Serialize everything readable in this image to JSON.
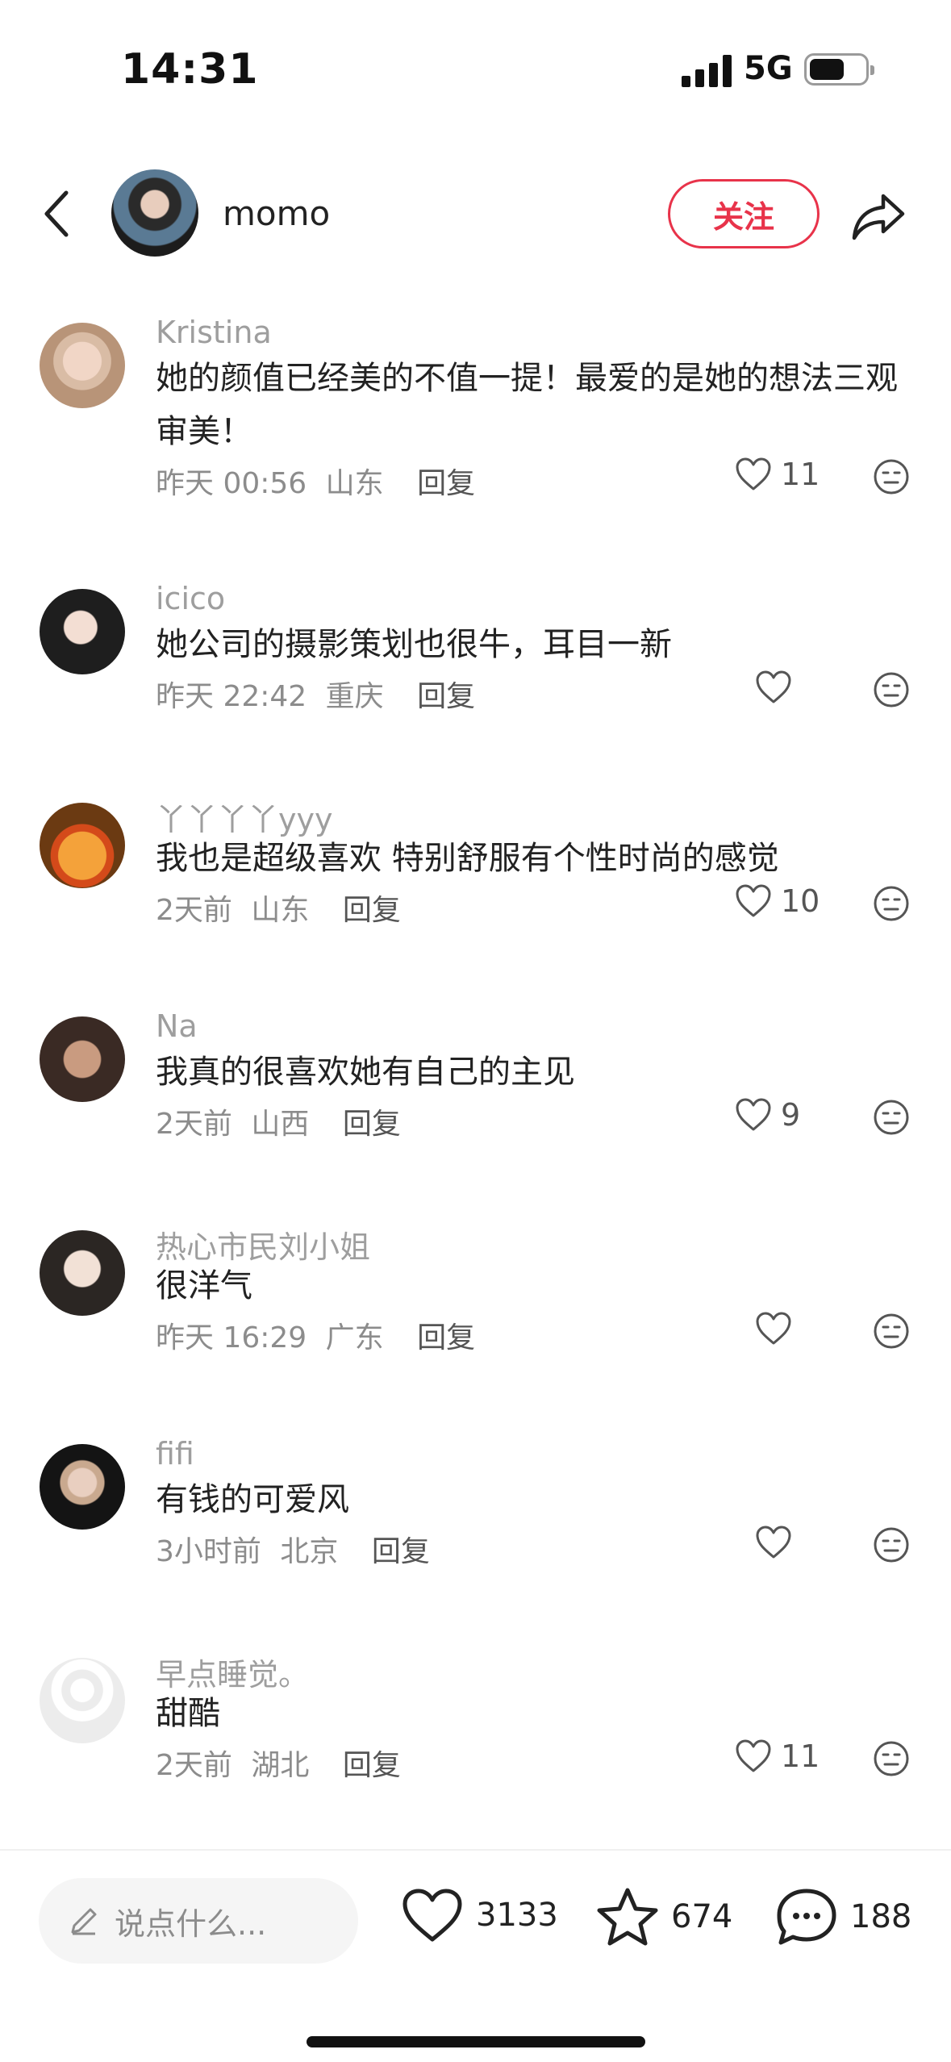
{
  "status_bar": {
    "time": "14:31",
    "network": "5G"
  },
  "header": {
    "author_name": "momo",
    "follow_label": "关注"
  },
  "comments": [
    {
      "user": "Kristina",
      "text": "她的颜值已经美的不值一提！最爱的是她的想法三观 审美！",
      "time": "昨天 00:56",
      "location": "山东",
      "reply_label": "回复",
      "likes": "11"
    },
    {
      "user": "icico",
      "text": "她公司的摄影策划也很牛，耳目一新",
      "time": "昨天 22:42",
      "location": "重庆",
      "reply_label": "回复",
      "likes": ""
    },
    {
      "user": "丫丫丫丫yyy",
      "text": "我也是超级喜欢 特别舒服有个性时尚的感觉",
      "time": "2天前",
      "location": "山东",
      "reply_label": "回复",
      "likes": "10"
    },
    {
      "user": "Na",
      "text": "我真的很喜欢她有自己的主见",
      "time": "2天前",
      "location": "山西",
      "reply_label": "回复",
      "likes": "9"
    },
    {
      "user": "热心市民刘小姐",
      "text": "很洋气",
      "time": "昨天 16:29",
      "location": "广东",
      "reply_label": "回复",
      "likes": ""
    },
    {
      "user": "fifi",
      "text": "有钱的可爱风",
      "time": "3小时前",
      "location": "北京",
      "reply_label": "回复",
      "likes": ""
    },
    {
      "user": "早点睡觉。",
      "text": "甜酷",
      "time": "2天前",
      "location": "湖北",
      "reply_label": "回复",
      "likes": "11"
    }
  ],
  "bottom_bar": {
    "input_placeholder": "说点什么...",
    "like_count": "3133",
    "collect_count": "674",
    "comment_count": "188"
  },
  "colors": {
    "accent": "#e8334a",
    "muted_text": "#9e9e9e",
    "bar_bg": "#f5f5f5"
  }
}
